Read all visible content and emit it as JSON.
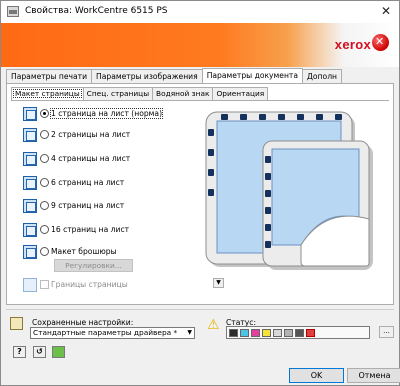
{
  "window": {
    "title": "Свойства: WorkCentre 6515 PS",
    "close": "✕"
  },
  "banner": {
    "logo": "xerox"
  },
  "main_tabs": [
    "Параметры печати",
    "Параметры изображения",
    "Параметры документа",
    "Дополн"
  ],
  "sub_tabs": [
    "Макет страницы",
    "Спец. страницы",
    "Водяной знак",
    "Ориентация"
  ],
  "layout_options": [
    {
      "label": "1 страница на лист (норма)",
      "selected": true
    },
    {
      "label": "2 страницы на лист",
      "selected": false
    },
    {
      "label": "4 страницы на лист",
      "selected": false
    },
    {
      "label": "6 страниц на лист",
      "selected": false
    },
    {
      "label": "9 страниц на лист",
      "selected": false
    },
    {
      "label": "16 страниц на лист",
      "selected": false
    },
    {
      "label": "Макет брошюры",
      "selected": false
    }
  ],
  "adjust_button": "Регулировки...",
  "page_borders": {
    "label": "Границы страницы",
    "checked": false,
    "enabled": false
  },
  "preview_dropdown": "▼",
  "saved_settings": {
    "label": "Сохраненные настройки:",
    "value": "Стандартные параметры драйвера *",
    "arrow": "▼"
  },
  "status": {
    "label": "Статус:",
    "more": "..."
  },
  "tools": {
    "help": "?",
    "reset": "↺"
  },
  "buttons": {
    "ok": "OK",
    "cancel": "Отмена"
  },
  "colors": {
    "accent_orange": "#ff6a14",
    "logo_red": "#d30e21",
    "selection_blue": "#0078d7"
  }
}
